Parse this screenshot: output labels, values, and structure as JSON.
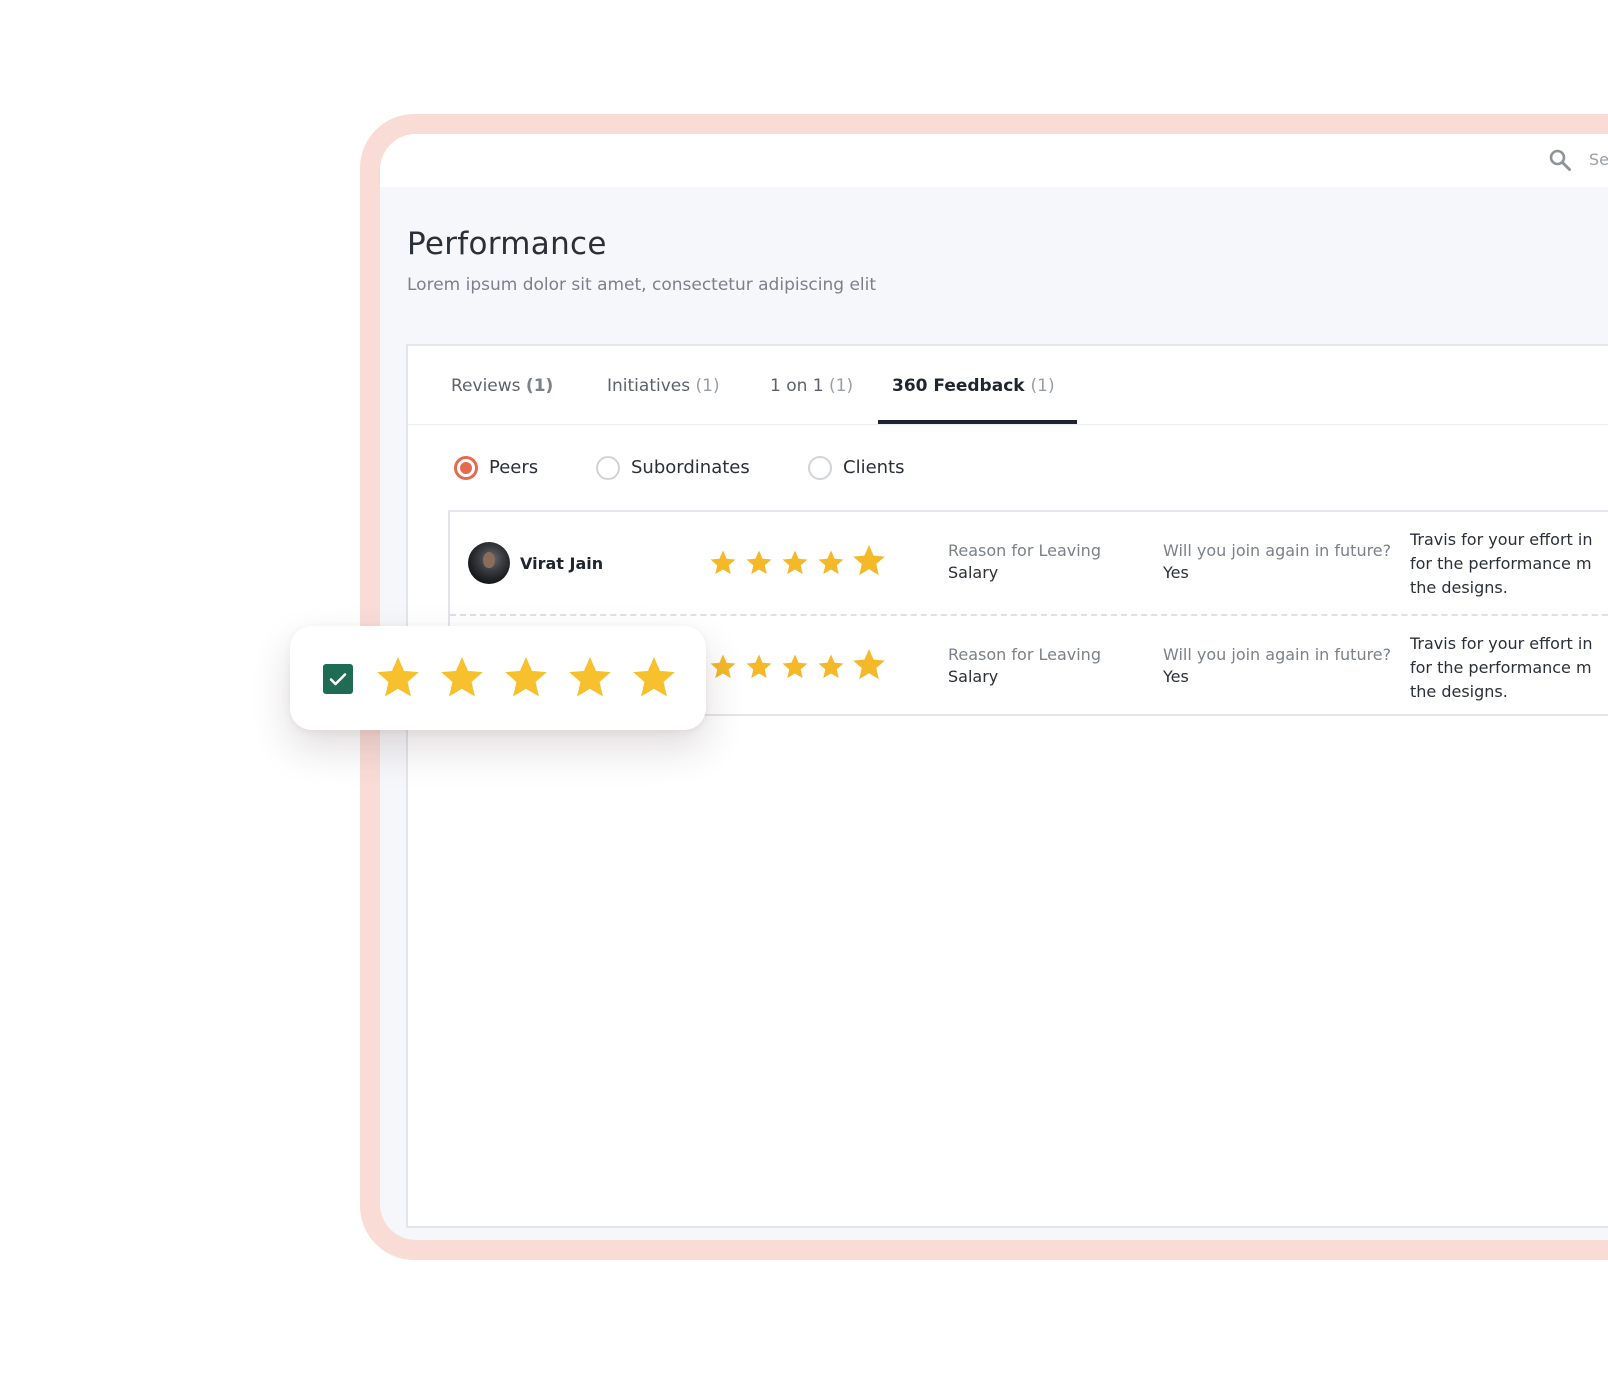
{
  "header": {
    "search_placeholder": "Se"
  },
  "page": {
    "title": "Performance",
    "subtitle": "Lorem ipsum dolor sit amet, consectetur adipiscing elit"
  },
  "tabs": [
    {
      "label": "Reviews",
      "count": "(1)"
    },
    {
      "label": "Initiatives",
      "count": "(1)"
    },
    {
      "label": "1 on 1",
      "count": "(1)"
    },
    {
      "label": "360 Feedback",
      "count": "(1)",
      "active": true
    }
  ],
  "filters": {
    "options": [
      "Peers",
      "Subordinates",
      "Clients"
    ],
    "selected": "Peers"
  },
  "feedback": [
    {
      "name": "Virat Jain",
      "rating": 5,
      "reason_label": "Reason for Leaving",
      "reason_value": "Salary",
      "rejoin_label": "Will you join again in future?",
      "rejoin_value": "Yes",
      "comment_lines": [
        "Travis for your effort in",
        "for the performance m",
        "the designs."
      ]
    },
    {
      "name": "",
      "rating": 5,
      "reason_label": "Reason for Leaving",
      "reason_value": "Salary",
      "rejoin_label": "Will you join again in future?",
      "rejoin_value": "Yes",
      "comment_lines": [
        "Travis for your effort in",
        "for the performance m",
        "the designs."
      ]
    }
  ],
  "rating_popup": {
    "checked": true,
    "stars": 5
  },
  "colors": {
    "frame": "#fadcd7",
    "accent_radio": "#e46a50",
    "star": "#f5b829",
    "checkbox": "#1f6b54",
    "active_tab": "#1f2530"
  }
}
